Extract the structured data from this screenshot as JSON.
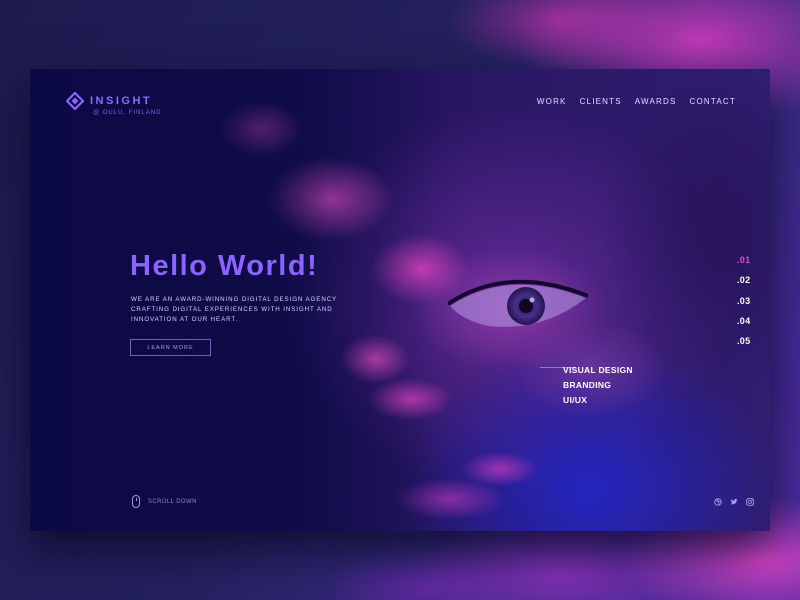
{
  "brand": {
    "name": "INSIGHT",
    "location": "@ OULU, FINLAND",
    "accent_color": "#8c63ff",
    "highlight_color": "#e44bc6"
  },
  "nav": {
    "items": [
      {
        "label": "WORK"
      },
      {
        "label": "CLIENTS"
      },
      {
        "label": "AWARDS"
      },
      {
        "label": "CONTACT"
      }
    ]
  },
  "hero": {
    "title": "Hello World!",
    "lines": [
      "WE ARE AN AWARD-WINNING DIGITAL DESIGN AGENCY",
      "CRAFTING DIGITAL EXPERIENCES WITH INSIGHT AND",
      "INNOVATION AT OUR HEART."
    ],
    "cta_label": "LEARN MORE"
  },
  "slides": {
    "items": [
      ".01",
      ".02",
      ".03",
      ".04",
      ".05"
    ],
    "active": ".01"
  },
  "services": {
    "items": [
      "VISUAL DESIGN",
      "BRANDING",
      "UI/UX"
    ]
  },
  "footer": {
    "scroll_label": "SCROLL DOWN",
    "social_icons": [
      "dribbble-icon",
      "twitter-icon",
      "instagram-icon"
    ]
  }
}
